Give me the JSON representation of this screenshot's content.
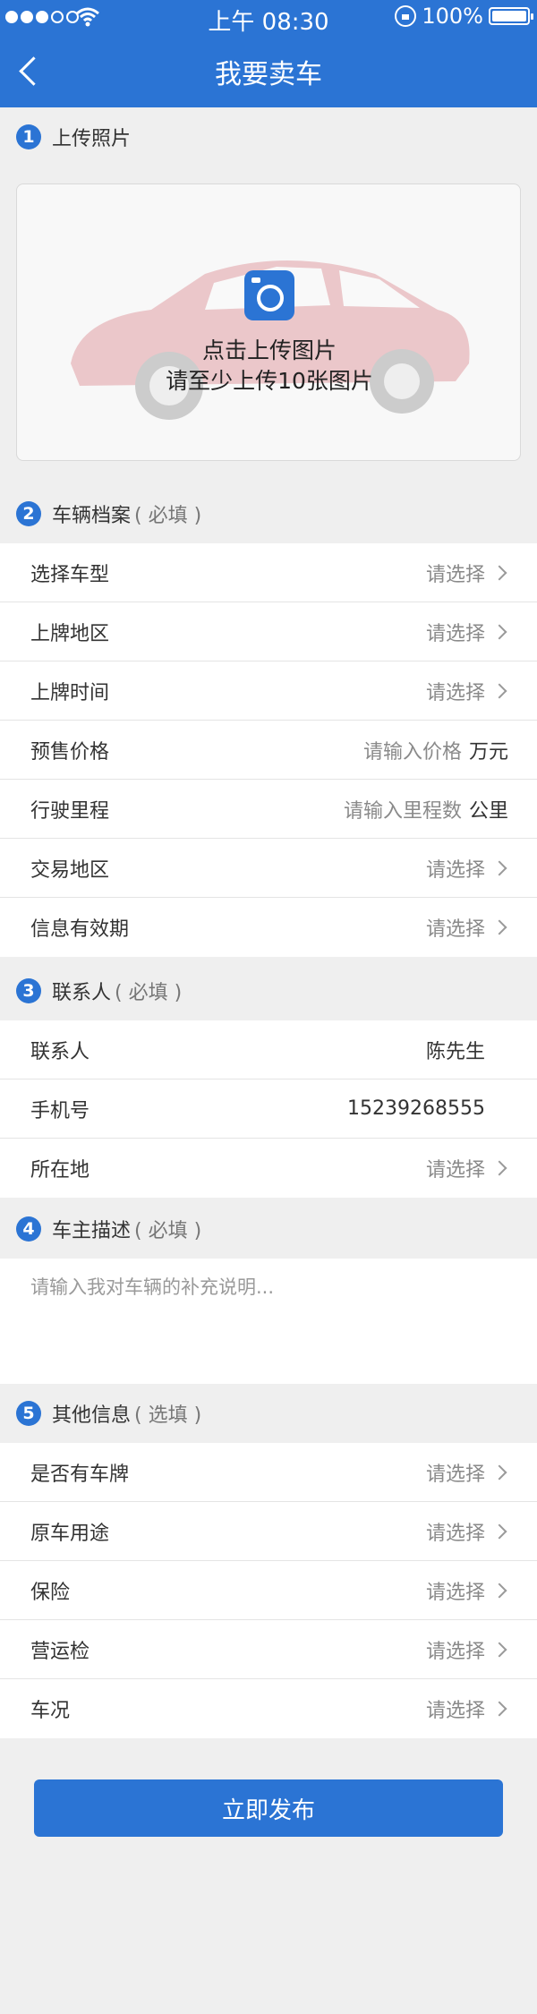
{
  "status": {
    "time": "上午 08:30",
    "battery": "100%"
  },
  "nav": {
    "title": "我要卖车"
  },
  "sections": {
    "photos": {
      "num": "1",
      "title": "上传照片",
      "note": ""
    },
    "vehicle": {
      "num": "2",
      "title": "车辆档案",
      "note": "( 必填 )"
    },
    "contact": {
      "num": "3",
      "title": "联系人",
      "note": "( 必填 )"
    },
    "desc": {
      "num": "4",
      "title": "车主描述",
      "note": "( 必填 )"
    },
    "other": {
      "num": "5",
      "title": "其他信息",
      "note": "( 选填 )"
    }
  },
  "upload": {
    "line1": "点击上传图片",
    "line2": "请至少上传10张图片"
  },
  "vehicle_rows": [
    {
      "label": "选择车型",
      "value": "请选择"
    },
    {
      "label": "上牌地区",
      "value": "请选择"
    },
    {
      "label": "上牌时间",
      "value": "请选择"
    },
    {
      "label": "预售价格",
      "placeholder": "请输入价格",
      "unit": "万元"
    },
    {
      "label": "行驶里程",
      "placeholder": "请输入里程数",
      "unit": "公里"
    },
    {
      "label": "交易地区",
      "value": "请选择"
    },
    {
      "label": "信息有效期",
      "value": "请选择"
    }
  ],
  "contact_rows": [
    {
      "label": "联系人",
      "value": "陈先生"
    },
    {
      "label": "手机号",
      "value": "15239268555"
    },
    {
      "label": "所在地",
      "value": "请选择"
    }
  ],
  "desc_placeholder": "请输入我对车辆的补充说明...",
  "other_rows": [
    {
      "label": "是否有车牌",
      "value": "请选择"
    },
    {
      "label": "原车用途",
      "value": "请选择"
    },
    {
      "label": "保险",
      "value": "请选择"
    },
    {
      "label": "营运检",
      "value": "请选择"
    },
    {
      "label": "车况",
      "value": "请选择"
    }
  ],
  "submit_label": "立即发布",
  "colors": {
    "primary": "#2b74d4",
    "background": "#efefef"
  }
}
